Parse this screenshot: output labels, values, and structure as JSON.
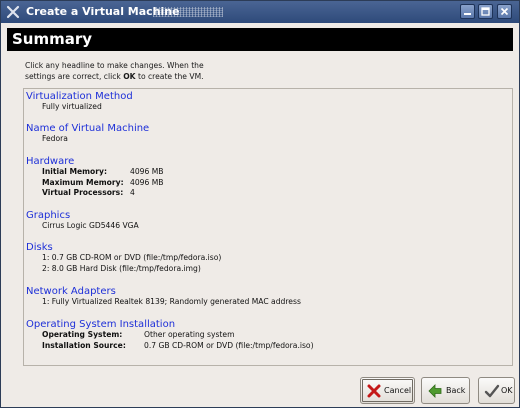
{
  "window": {
    "title": "Create a Virtual Machine"
  },
  "header": {
    "title": "Summary"
  },
  "instructions": {
    "line1": "Click any headline to make changes.  When the",
    "line2_prefix": "settings are correct, click ",
    "line2_bold": "OK",
    "line2_suffix": " to create the VM."
  },
  "sections": {
    "virtualization": {
      "heading": "Virtualization Method",
      "value": "Fully virtualized"
    },
    "name": {
      "heading": "Name of Virtual Machine",
      "value": "Fedora"
    },
    "hardware": {
      "heading": "Hardware",
      "rows": [
        {
          "label": "Initial Memory:",
          "value": "4096 MB"
        },
        {
          "label": "Maximum Memory:",
          "value": "4096 MB"
        },
        {
          "label": "Virtual Processors:",
          "value": "4"
        }
      ]
    },
    "graphics": {
      "heading": "Graphics",
      "value": "Cirrus Logic GD5446 VGA"
    },
    "disks": {
      "heading": "Disks",
      "items": [
        "1: 0.7 GB CD-ROM or DVD (file:/tmp/fedora.iso)",
        "2: 8.0 GB Hard Disk (file:/tmp/fedora.img)"
      ]
    },
    "network": {
      "heading": "Network Adapters",
      "items": [
        "1: Fully Virtualized Realtek 8139; Randomly generated MAC address"
      ]
    },
    "os": {
      "heading": "Operating System Installation",
      "rows": [
        {
          "label": "Operating System:",
          "value": "Other operating system"
        },
        {
          "label": "Installation Source:",
          "value": "0.7 GB CD-ROM or DVD (file:/tmp/fedora.iso)"
        }
      ]
    }
  },
  "buttons": {
    "cancel": "Cancel",
    "back": "Back",
    "ok": "OK"
  },
  "icons": {
    "app": "x-logo-icon",
    "minimize": "minimize-icon",
    "maximize": "maximize-icon",
    "close": "close-icon",
    "cancel": "red-x-icon",
    "back": "green-arrow-left-icon",
    "ok": "check-icon"
  },
  "colors": {
    "titlebar": "#2e4a7a",
    "header_bg": "#000000",
    "heading_link": "#1d2fd8",
    "window_bg": "#efebe7"
  }
}
